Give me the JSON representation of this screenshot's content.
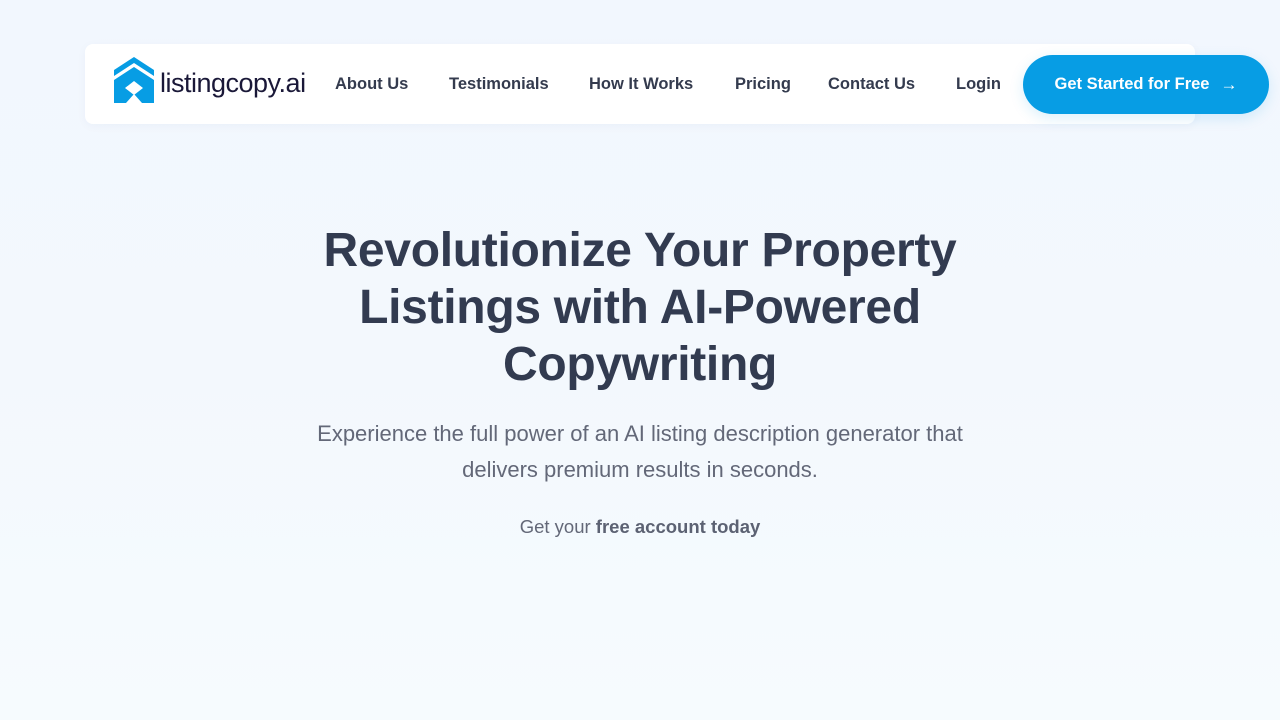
{
  "brand": {
    "name": "listingcopy.ai",
    "logo_icon": "house-chevron-icon",
    "accent_color": "#079de4",
    "text_color": "#1a1838"
  },
  "nav": {
    "items": [
      {
        "label": "About Us"
      },
      {
        "label": "Testimonials"
      },
      {
        "label": "How It Works"
      },
      {
        "label": "Pricing"
      },
      {
        "label": "Contact Us"
      },
      {
        "label": "Login"
      }
    ],
    "cta_label": "Get Started for Free",
    "cta_icon": "arrow-right-icon",
    "cta_arrow": "→"
  },
  "hero": {
    "title": "Revolutionize Your Property Listings with AI-Powered Copywriting",
    "subtitle": "Experience the full power of an AI listing description generator that delivers premium results in seconds.",
    "note_prefix": "Get your ",
    "note_emphasis": "free account today",
    "title_color": "#323b50",
    "body_color": "#636878"
  }
}
